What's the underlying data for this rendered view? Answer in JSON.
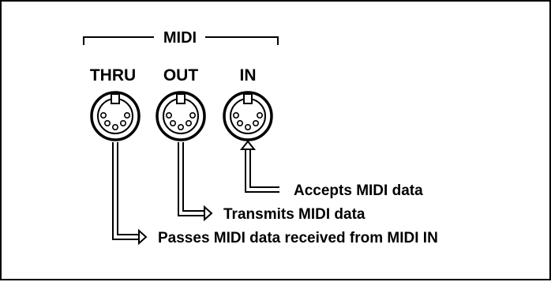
{
  "diagram": {
    "group_label": "MIDI",
    "ports": [
      {
        "id": "thru",
        "label": "THRU",
        "description": "Passes MIDI data received from MIDI IN"
      },
      {
        "id": "out",
        "label": "OUT",
        "description": "Transmits MIDI data"
      },
      {
        "id": "in",
        "label": "IN",
        "description": "Accepts MIDI data"
      }
    ],
    "colors": {
      "stroke": "#000000",
      "background": "#ffffff"
    }
  }
}
